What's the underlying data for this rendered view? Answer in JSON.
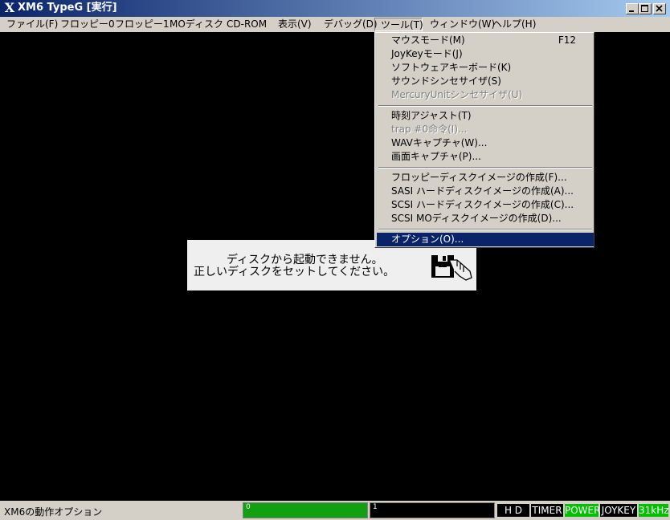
{
  "window": {
    "title": "XM6 TypeG [実行]",
    "app_icon_glyph": "X"
  },
  "menubar": {
    "items": [
      {
        "label": "ファイル(F)"
      },
      {
        "label": "フロッピー0"
      },
      {
        "label": "フロッピー1"
      },
      {
        "label": "MOディスク"
      },
      {
        "label": "CD-ROM"
      },
      {
        "label": "表示(V)"
      },
      {
        "label": "デバッグ(D)"
      },
      {
        "label": "ツール(T)"
      },
      {
        "label": "ウィンドウ(W)"
      },
      {
        "label": "ヘルプ(H)"
      }
    ],
    "open_item": "ツール(T)"
  },
  "tools_menu": {
    "items": [
      {
        "label": "マウスモード(M)",
        "accel": "F12",
        "enabled": true
      },
      {
        "label": "JoyKeyモード(J)",
        "enabled": true
      },
      {
        "label": "ソフトウェアキーボード(K)",
        "enabled": true
      },
      {
        "label": "サウンドシンセサイザ(S)",
        "enabled": true
      },
      {
        "label": "MercuryUnitシンセサイザ(U)",
        "enabled": false
      },
      {
        "label": "時刻アジャスト(T)",
        "enabled": true
      },
      {
        "label": "trap #0命令(I)...",
        "enabled": false
      },
      {
        "label": "WAVキャプチャ(W)...",
        "enabled": true
      },
      {
        "label": "画面キャプチャ(P)...",
        "enabled": true
      },
      {
        "label": "フロッピーディスクイメージの作成(F)...",
        "enabled": true
      },
      {
        "label": "SASI ハードディスクイメージの作成(A)...",
        "enabled": true
      },
      {
        "label": "SCSI ハードディスクイメージの作成(C)...",
        "enabled": true
      },
      {
        "label": "SCSI MOディスクイメージの作成(D)...",
        "enabled": true
      },
      {
        "label": "オプション(O)...",
        "enabled": true,
        "highlighted": true
      }
    ]
  },
  "emulator_screen": {
    "message_line1": "ディスクから起動できません。",
    "message_line2": "正しいディスクをセットしてください。",
    "icon": "insert-disk-icon"
  },
  "statusbar": {
    "message": "XM6の動作オプション",
    "fdd0_label": "0",
    "fdd1_label": "1",
    "indicators": [
      {
        "label": "H D",
        "on": false
      },
      {
        "label": "TIMER",
        "on": false
      },
      {
        "label": "POWER",
        "on": true
      },
      {
        "label": "JOYKEY",
        "on": false
      },
      {
        "label": "31kHz",
        "on": true
      }
    ]
  },
  "colors": {
    "title_active": "#0a246a",
    "menu_highlight": "#0a246a",
    "fdd0_access": "#10a010",
    "indicator_on": "#00c000",
    "screen_bg": "#000000"
  }
}
